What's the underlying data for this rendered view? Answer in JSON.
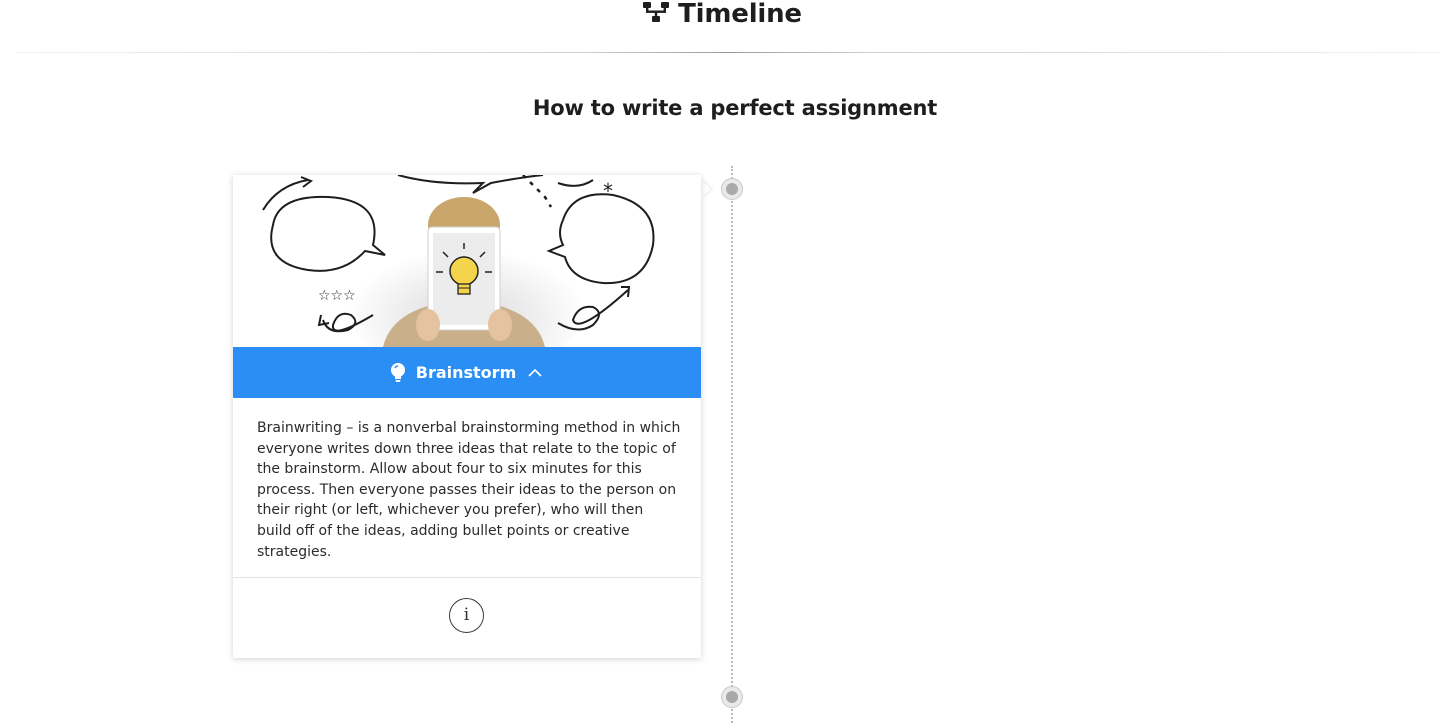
{
  "header": {
    "icon": "timeline-icon",
    "title": "Timeline"
  },
  "page": {
    "heading": "How to write a perfect assignment"
  },
  "timeline": {
    "items": [
      {
        "image": "brainstorm-illustration",
        "title": "Brainstorm",
        "title_icon": "lightbulb-icon",
        "toggle_icon": "chevron-up-icon",
        "expanded": true,
        "body": "Brainwriting – is a nonverbal brainstorming method in which everyone writes down three ideas that relate to the topic of the brainstorm. Allow about four to six minutes for this process. Then everyone passes their ideas to the person on their right (or left, whichever you prefer), who will then build off of the ideas, adding bullet points or creative strategies.",
        "info_label": "i",
        "info_icon": "info-icon"
      }
    ]
  },
  "colors": {
    "accent": "#2a8ef4",
    "text": "#2b2b2b",
    "heading": "#1e1e1e",
    "dot": "#a9a9a9"
  }
}
